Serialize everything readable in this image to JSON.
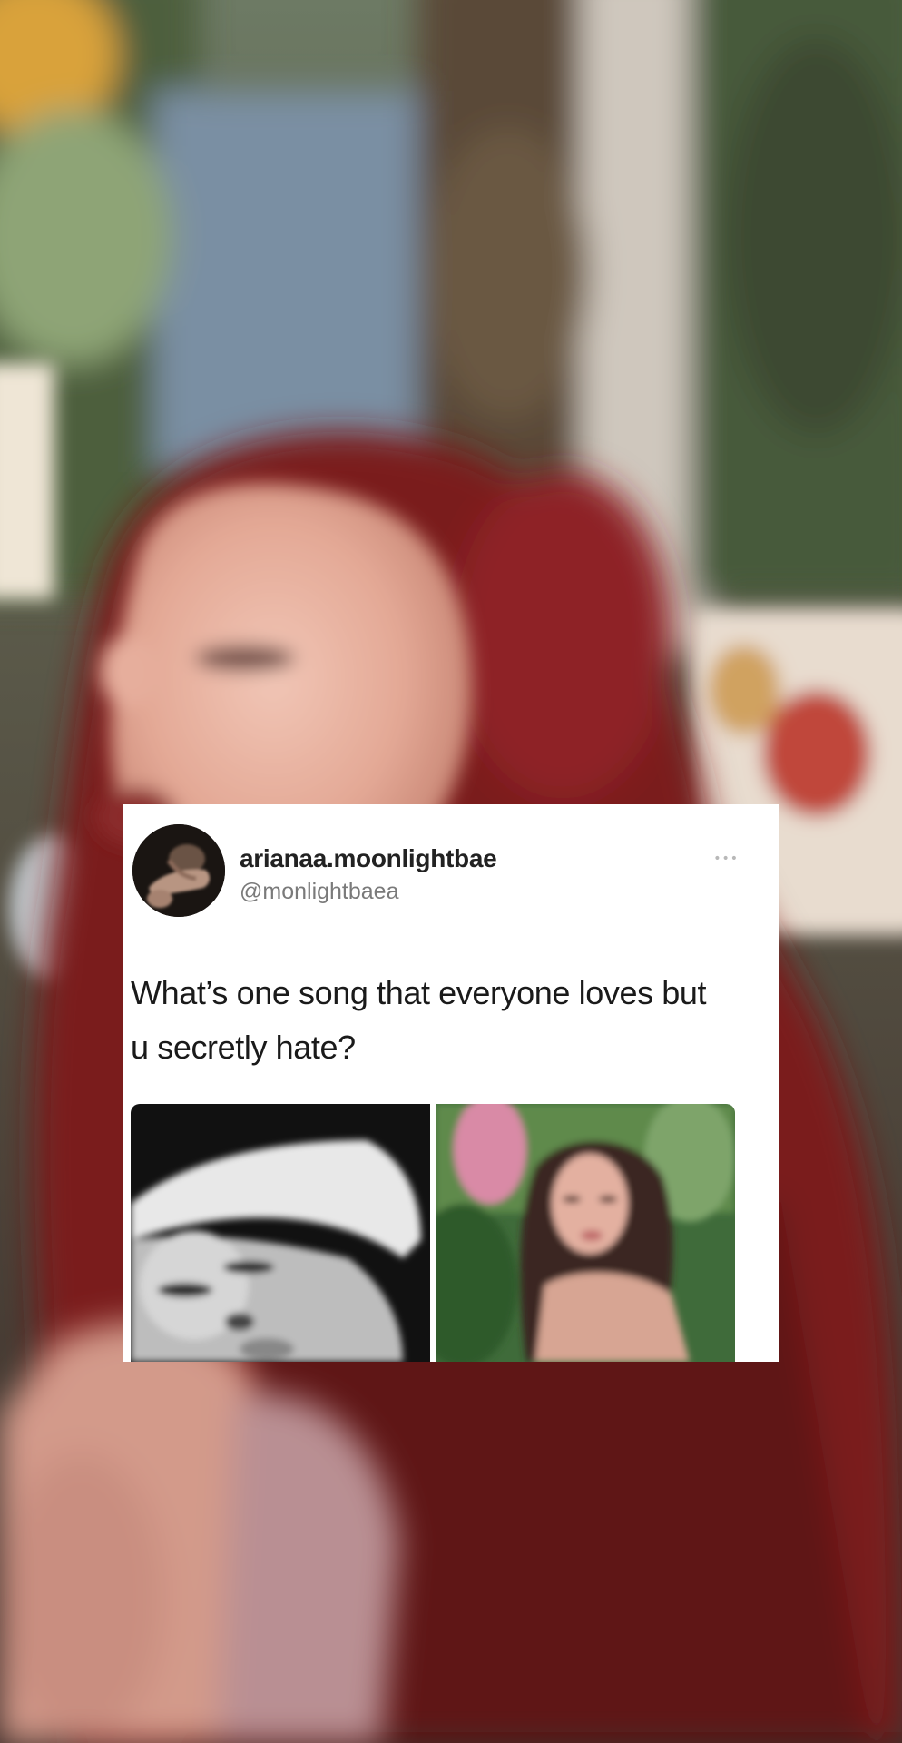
{
  "tweet": {
    "display_name": "arianaa.moonlightbae",
    "handle": "@monlightbaea",
    "text": "What’s one song that everyone loves but u secretly hate?",
    "more_icon": "more-dots-icon"
  },
  "colors": {
    "hair_red": "#7a1a1e",
    "card_bg": "#ffffff",
    "name_text": "#222222",
    "handle_text": "#7a7a7a"
  }
}
